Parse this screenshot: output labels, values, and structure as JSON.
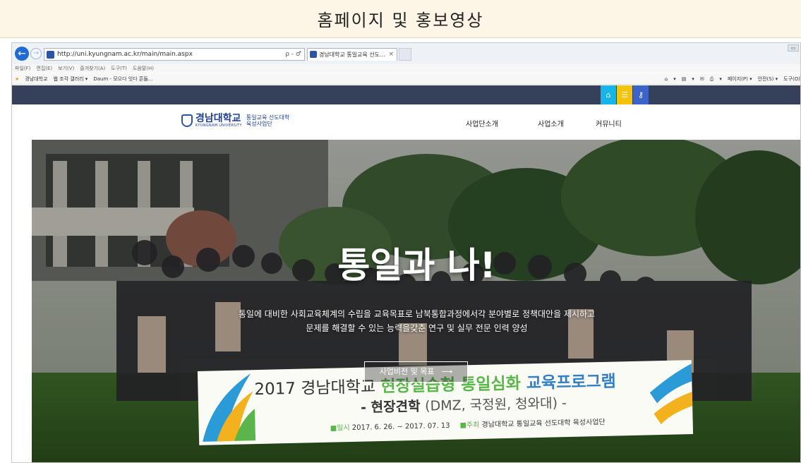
{
  "slide_title": "홈페이지 및 홍보영상",
  "browser": {
    "url": "http://uni.kyungnam.ac.kr/main/main.aspx",
    "addr_tools": "ρ - ♂",
    "tab_title": "경남대학교 통일교육 선도...",
    "tab_close": "×",
    "menu": [
      "파일(F)",
      "편집(E)",
      "보기(V)",
      "즐겨찾기(A)",
      "도구(T)",
      "도움말(H)"
    ],
    "favorites": [
      "경남대학교",
      "웹 조각 갤러리 ▾",
      "Daum - 모으다 잇다 흔들..."
    ],
    "command_bar": [
      "▾",
      "▾",
      "▾",
      "페이지(P) ▾",
      "안전(S) ▾",
      "도구(O)"
    ]
  },
  "site": {
    "logo_main": "경남대학교",
    "logo_eng": "KYUNGNAM UNIVERSITY",
    "logo_sub_1": "통일교육 선도대학",
    "logo_sub_2": "육성사업단",
    "nav": [
      "사업단소개",
      "사업소개",
      "커뮤니티"
    ]
  },
  "hero": {
    "title": "통일과 나!",
    "desc_1": "통일에 대비한 사회교육체계의 수립을 교육목표로 남북통합과정에서각 분야별로 정책대안을 제시하고",
    "desc_2": "문제를 해결할 수 있는 능력을갖춘 연구 및 실무 전문 인력 양성",
    "button_label": "사업비전 및 목표",
    "button_arrow": "⟶"
  },
  "banner": {
    "l1_a": "2017 경남대학교 ",
    "l1_b": "현장실습형 통일심화 ",
    "l1_c": "교육프로그램",
    "l2_a": "- 현장견학 ",
    "l2_b": "(DMZ, 국정원, 청와대) -",
    "l3_label1": "■일시 ",
    "l3_date": "2017. 6. 26. ~ 2017. 07. 13",
    "l3_label2": "■주최 ",
    "l3_org": "경남대학교 통일교육 선도대학 육성사업단"
  },
  "colors": {
    "site_topbar": "#35405a",
    "home_btn": "#17b4e8",
    "menu_btn": "#f5c30c",
    "key_btn": "#3b63c8",
    "banner_green": "#59b74a",
    "banner_blue": "#3580c5"
  }
}
